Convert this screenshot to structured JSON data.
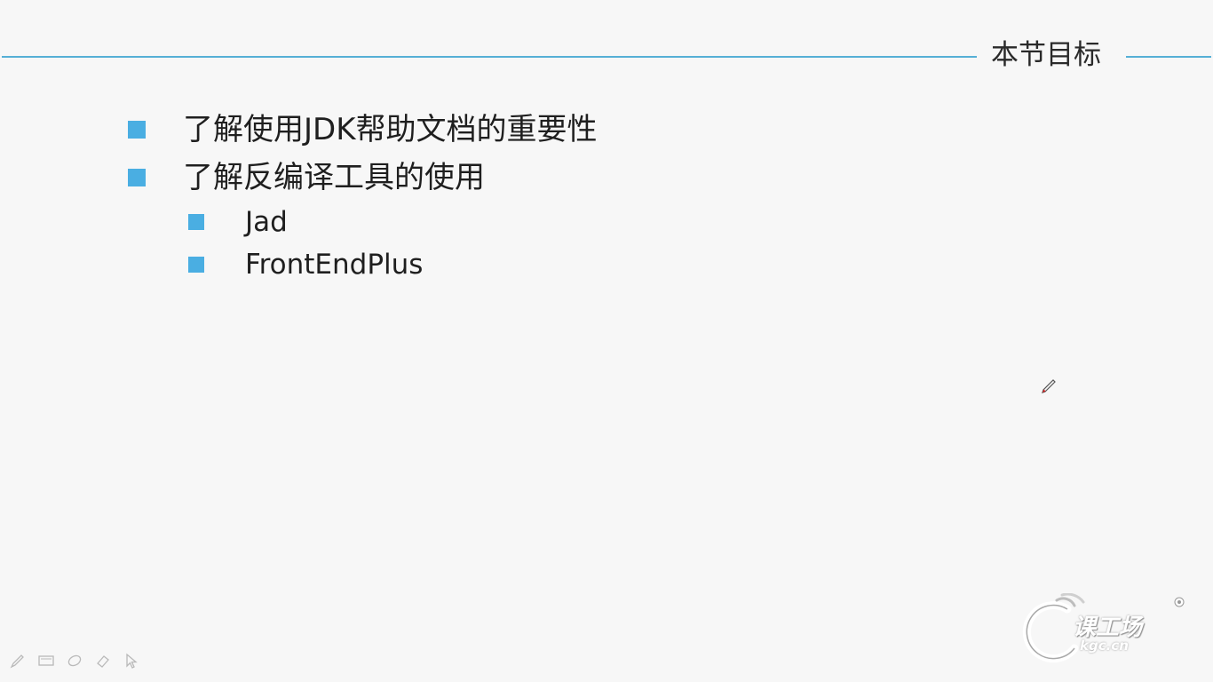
{
  "slide": {
    "title": "本节目标",
    "bullets": [
      {
        "text": "了解使用JDK帮助文档的重要性"
      },
      {
        "text": "了解反编译工具的使用"
      }
    ],
    "sub_bullets": [
      {
        "text": "Jad"
      },
      {
        "text": "FrontEndPlus"
      }
    ]
  },
  "logo": {
    "main": "课工场",
    "sub": "kgc.cn"
  },
  "toolbar": {
    "tools": [
      "pen-icon",
      "screen-icon",
      "highlighter-icon",
      "eraser-icon",
      "pointer-icon"
    ]
  },
  "colors": {
    "accent": "#56b0d6",
    "bullet": "#4aaee2",
    "text": "#1f1f1f"
  }
}
